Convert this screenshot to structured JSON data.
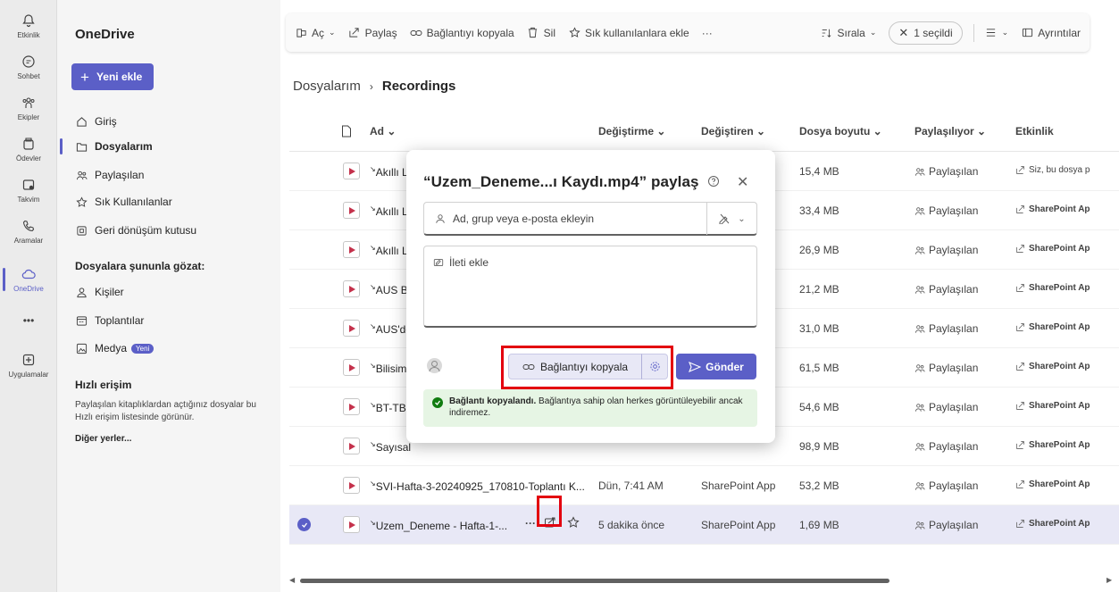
{
  "rail": {
    "items": [
      {
        "label": "Etkinlik",
        "icon": "bell-icon"
      },
      {
        "label": "Sohbet",
        "icon": "chat-icon"
      },
      {
        "label": "Ekipler",
        "icon": "teams-icon"
      },
      {
        "label": "Ödevler",
        "icon": "assignments-icon"
      },
      {
        "label": "Takvim",
        "icon": "calendar-icon"
      },
      {
        "label": "Aramalar",
        "icon": "phone-icon"
      },
      {
        "label": "OneDrive",
        "icon": "cloud-icon"
      },
      {
        "label": "•••",
        "icon": "more-icon"
      },
      {
        "label": "Uygulamalar",
        "icon": "apps-icon"
      }
    ]
  },
  "leftnav": {
    "title": "OneDrive",
    "new_button": "Yeni ekle",
    "items": [
      {
        "label": "Giriş",
        "icon": "home-icon"
      },
      {
        "label": "Dosyalarım",
        "icon": "folder-icon"
      },
      {
        "label": "Paylaşılan",
        "icon": "shared-icon"
      },
      {
        "label": "Sık Kullanılanlar",
        "icon": "star-icon"
      },
      {
        "label": "Geri dönüşüm kutusu",
        "icon": "recycle-icon"
      }
    ],
    "browse_section": "Dosyalara şununla gözat:",
    "browse_items": [
      {
        "label": "Kişiler",
        "icon": "person-icon"
      },
      {
        "label": "Toplantılar",
        "icon": "meeting-icon"
      },
      {
        "label": "Medya",
        "icon": "media-icon",
        "badge": "Yeni"
      }
    ],
    "quick_access_title": "Hızlı erişim",
    "quick_access_desc": "Paylaşılan kitaplıklardan açtığınız dosyalar bu Hızlı erişim listesinde görünür.",
    "other_places": "Diğer yerler..."
  },
  "toolbar": {
    "open": "Aç",
    "share": "Paylaş",
    "copy_link": "Bağlantıyı kopyala",
    "delete": "Sil",
    "add_favorites": "Sık kullanılanlara ekle",
    "more": "···",
    "sort": "Sırala",
    "selected": "1 seçildi",
    "details": "Ayrıntılar"
  },
  "breadcrumb": {
    "root": "Dosyalarım",
    "sep": "›",
    "current": "Recordings"
  },
  "table": {
    "headers": {
      "name": "Ad",
      "modified": "Değiştirme",
      "modified_by": "Değiştiren",
      "size": "Dosya boyutu",
      "sharing": "Paylaşılıyor",
      "activity": "Etkinlik"
    },
    "rows": [
      {
        "name": "Akıllı Lo",
        "modified": "",
        "modified_by": "",
        "size": "15,4 MB",
        "sharing": "Paylaşılan",
        "activity": "Siz, bu dosya p",
        "activity_bold": false
      },
      {
        "name": "Akıllı Lo",
        "modified": "",
        "modified_by": "",
        "size": "33,4 MB",
        "sharing": "Paylaşılan",
        "activity": "SharePoint Ap",
        "activity_bold": true
      },
      {
        "name": "Akıllı Lo",
        "modified": "",
        "modified_by": "",
        "size": "26,9 MB",
        "sharing": "Paylaşılan",
        "activity": "SharePoint Ap",
        "activity_bold": true
      },
      {
        "name": "AUS Blo",
        "modified": "",
        "modified_by": "",
        "size": "21,2 MB",
        "sharing": "Paylaşılan",
        "activity": "SharePoint Ap",
        "activity_bold": true
      },
      {
        "name": "AUS'de",
        "modified": "",
        "modified_by": "",
        "size": "31,0 MB",
        "sharing": "Paylaşılan",
        "activity": "SharePoint Ap",
        "activity_bold": true
      },
      {
        "name": "Bilisim",
        "modified": "",
        "modified_by": "",
        "size": "61,5 MB",
        "sharing": "Paylaşılan",
        "activity": "SharePoint Ap",
        "activity_bold": true
      },
      {
        "name": "BT-TBT",
        "modified": "",
        "modified_by": "",
        "size": "54,6 MB",
        "sharing": "Paylaşılan",
        "activity": "SharePoint Ap",
        "activity_bold": true
      },
      {
        "name": "Sayısal",
        "modified": "",
        "modified_by": "",
        "size": "98,9 MB",
        "sharing": "Paylaşılan",
        "activity": "SharePoint Ap",
        "activity_bold": true
      },
      {
        "name": "SVI-Hafta-3-20240925_170810-Toplantı K...",
        "modified": "Dün, 7:41 AM",
        "modified_by": "SharePoint App",
        "size": "53,2 MB",
        "sharing": "Paylaşılan",
        "activity": "SharePoint Ap",
        "activity_bold": true
      },
      {
        "name": "Uzem_Deneme - Hafta-1-...",
        "modified": "5 dakika önce",
        "modified_by": "SharePoint App",
        "size": "1,69 MB",
        "sharing": "Paylaşılan",
        "activity": "SharePoint Ap",
        "activity_bold": true,
        "selected": true
      }
    ],
    "row_more": "···"
  },
  "dialog": {
    "title": "“Uzem_Deneme...ı Kaydı.mp4” paylaş",
    "people_placeholder": "Ad, grup veya e-posta ekleyin",
    "message_placeholder": "İleti ekle",
    "copy_link": "Bağlantıyı kopyala",
    "send": "Gönder",
    "toast_bold": "Bağlantı kopyalandı.",
    "toast_text": " Bağlantıya sahip olan herkes görüntüleyebilir ancak indiremez."
  },
  "colors": {
    "accent": "#5b5fc7",
    "highlight": "#e3000f",
    "success_bg": "#e6f5e4",
    "success": "#107c10"
  }
}
